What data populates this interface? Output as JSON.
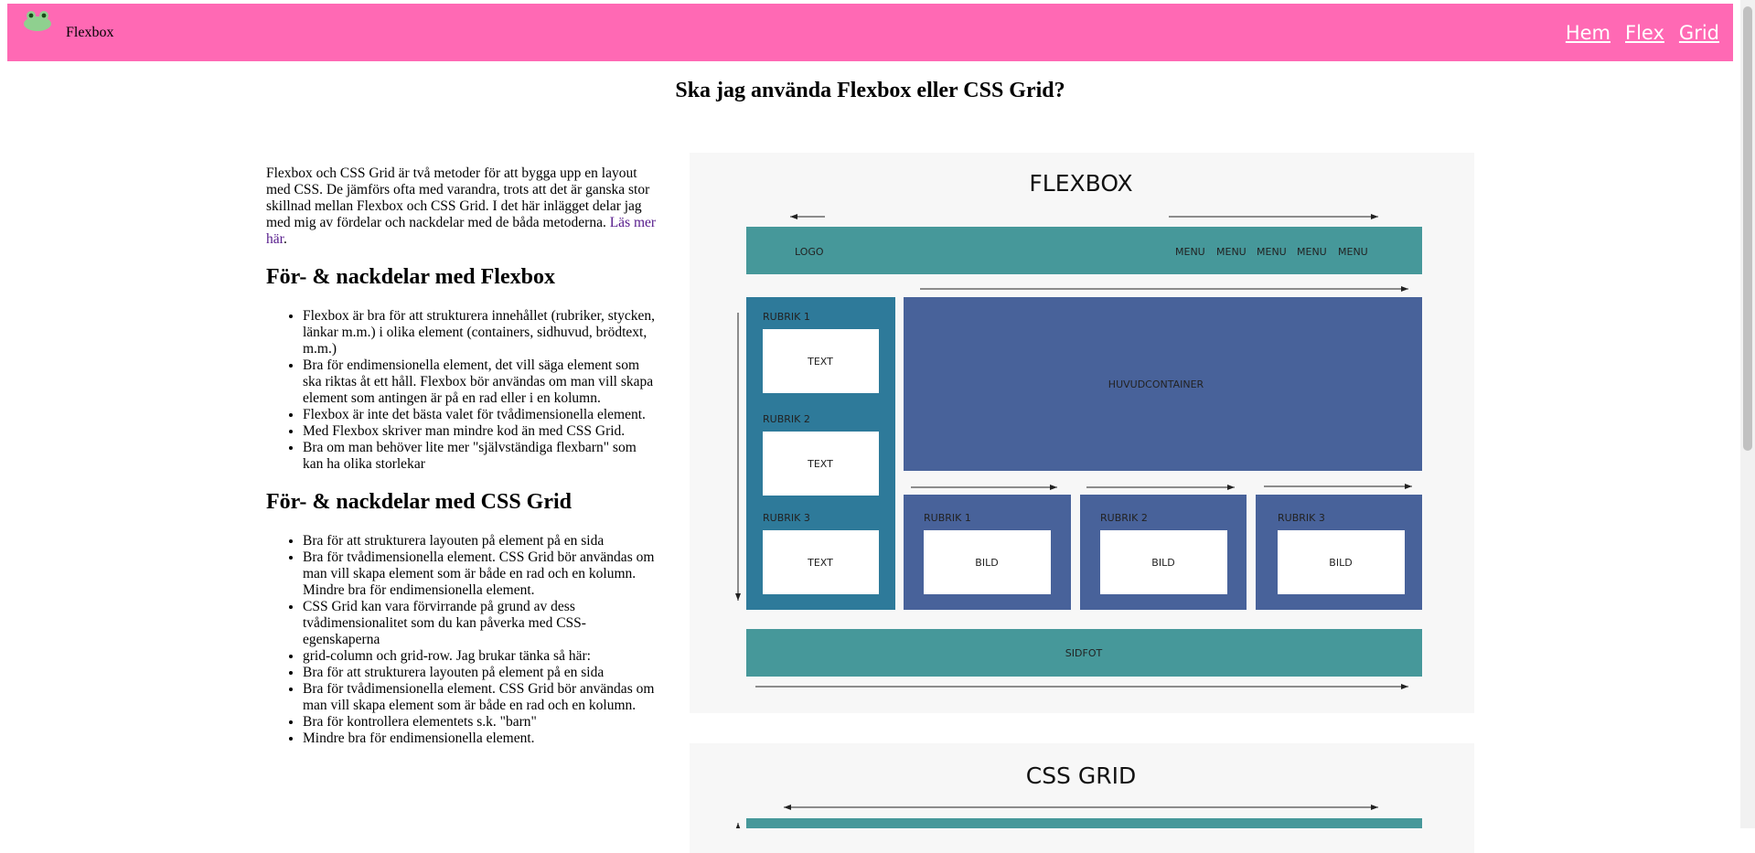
{
  "header": {
    "brand": "Flexbox",
    "nav": [
      "Hem",
      "Flex",
      "Grid"
    ],
    "accent": "#ff69b4"
  },
  "page_title": "Ska jag använda Flexbox eller CSS Grid?",
  "intro": {
    "text": "Flexbox och CSS Grid är två metoder för att bygga upp en layout med CSS. De jämförs ofta med varandra, trots att det är ganska stor skillnad mellan Flexbox och CSS Grid. I det här inlägget delar jag med mig av fördelar och nackdelar med de båda metoderna.",
    "link": "Läs mer här",
    "after": "."
  },
  "flex_section": {
    "heading": "För- & nackdelar med Flexbox",
    "items": [
      "Flexbox är bra för att strukturera innehållet (rubriker, stycken, länkar m.m.) i olika element (containers, sidhuvud, brödtext, m.m.)",
      "Bra för endimensionella element, det vill säga element som ska riktas åt ett håll. Flexbox bör användas om man vill skapa element som antingen är på en rad eller i en kolumn.",
      "Flexbox är inte det bästa valet för tvådimensionella element.",
      "Med Flexbox skriver man mindre kod än med CSS Grid.",
      "Bra om man behöver lite mer \"självständiga flexbarn\" som kan ha olika storlekar"
    ]
  },
  "grid_section": {
    "heading": "För- & nackdelar med CSS Grid",
    "items": [
      "Bra för att strukturera layouten på element på en sida",
      "Bra för tvådimensionella element. CSS Grid bör användas om man vill skapa element som är både en rad och en kolumn. Mindre bra för endimensionella element.",
      "CSS Grid kan vara förvirrande på grund av dess tvådimensionalitet som du kan påverka med CSS-egenskaperna",
      "grid-column och grid-row. Jag brukar tänka så här:",
      "Bra för att strukturera layouten på element på en sida",
      "Bra för tvådimensionella element. CSS Grid bör användas om man vill skapa element som är både en rad och en kolumn.",
      "Bra för kontrollera elementets s.k. \"barn\"",
      "Mindre bra för endimensionella element."
    ]
  },
  "diagram_flex": {
    "title": "FLEXBOX",
    "logo": "LOGO",
    "menu": [
      "MENU",
      "MENU",
      "MENU",
      "MENU",
      "MENU"
    ],
    "sidebar": [
      {
        "heading": "RUBRIK 1",
        "box": "TEXT"
      },
      {
        "heading": "RUBRIK 2",
        "box": "TEXT"
      },
      {
        "heading": "RUBRIK 3",
        "box": "TEXT"
      }
    ],
    "main": "HUVUDCONTAINER",
    "cards": [
      {
        "heading": "RUBRIK 1",
        "box": "BILD"
      },
      {
        "heading": "RUBRIK 2",
        "box": "BILD"
      },
      {
        "heading": "RUBRIK 3",
        "box": "BILD"
      }
    ],
    "footer": "SIDFOT",
    "colors": {
      "teal": "#46989a",
      "sidebar": "#2e7a9a",
      "blue": "#48629a"
    }
  },
  "diagram_grid": {
    "title": "CSS GRID"
  }
}
